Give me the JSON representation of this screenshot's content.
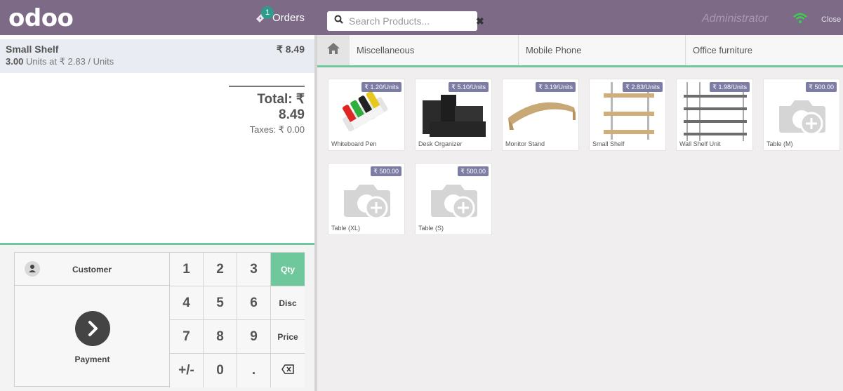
{
  "header": {
    "logo": "odoo",
    "orders_label": "Orders",
    "orders_count": "1",
    "search_placeholder": "Search Products...",
    "user": "Administrator",
    "close_label": "Close"
  },
  "order": {
    "line": {
      "name": "Small Shelf",
      "price": "₹ 8.49",
      "qty": "3.00",
      "unit_text": "Units at ₹ 2.83 / Units"
    },
    "total_label": "Total: ₹ 8.49",
    "taxes_label": "Taxes: ₹ 0.00"
  },
  "pad": {
    "customer_label": "Customer",
    "payment_label": "Payment",
    "keys": {
      "k1": "1",
      "k2": "2",
      "k3": "3",
      "k4": "4",
      "k5": "5",
      "k6": "6",
      "k7": "7",
      "k8": "8",
      "k9": "9",
      "plusminus": "+/-",
      "k0": "0",
      "dot": "."
    },
    "modes": {
      "qty": "Qty",
      "disc": "Disc",
      "price": "Price"
    },
    "active_mode": "Qty",
    "backspace_icon": "backspace-icon"
  },
  "categories": [
    {
      "label": "Miscellaneous"
    },
    {
      "label": "Mobile Phone"
    },
    {
      "label": "Office furniture"
    }
  ],
  "products": [
    {
      "name": "Whiteboard Pen",
      "price": "₹ 1.20/Units",
      "image": "whiteboard-pen"
    },
    {
      "name": "Desk Organizer",
      "price": "₹ 5.10/Units",
      "image": "desk-organizer"
    },
    {
      "name": "Monitor Stand",
      "price": "₹ 3.19/Units",
      "image": "monitor-stand"
    },
    {
      "name": "Small Shelf",
      "price": "₹ 2.83/Units",
      "image": "small-shelf"
    },
    {
      "name": "Wall Shelf Unit",
      "price": "₹ 1.98/Units",
      "image": "wall-shelf"
    },
    {
      "name": "Table (M)",
      "price": "₹ 500.00",
      "image": "placeholder-camera"
    },
    {
      "name": "Table (XL)",
      "price": "₹ 500.00",
      "image": "placeholder-camera"
    },
    {
      "name": "Table (S)",
      "price": "₹ 500.00",
      "image": "placeholder-camera"
    }
  ],
  "colors": {
    "header": "#7c6a87",
    "accent": "#6ec89b",
    "price_tag": "#7d7ca5",
    "badge": "#2e9b8d"
  }
}
